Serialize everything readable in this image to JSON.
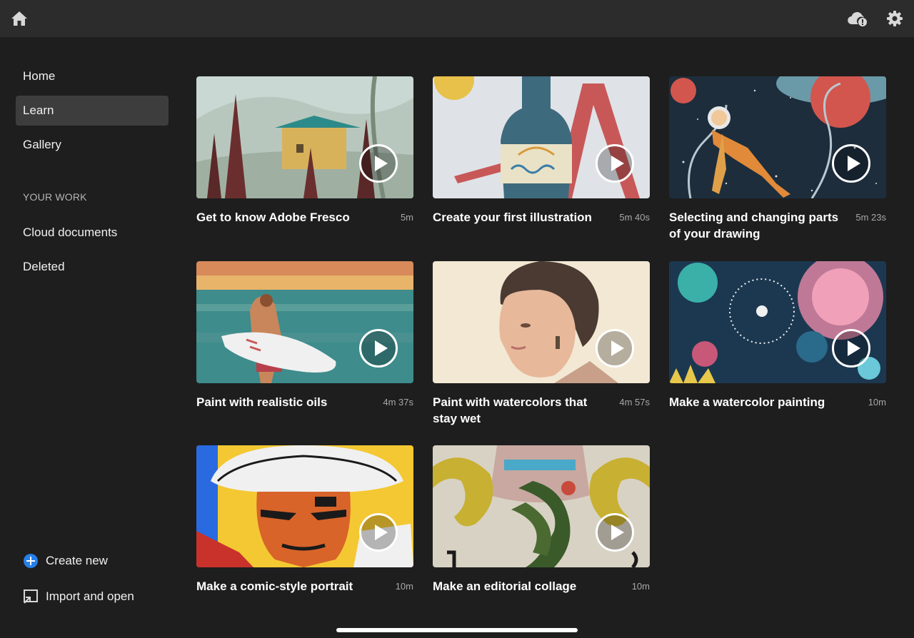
{
  "topbar": {
    "home_icon": "home-icon",
    "cloud_icon": "cloud-alert-icon",
    "settings_icon": "gear-icon"
  },
  "sidebar": {
    "items": [
      {
        "label": "Home"
      },
      {
        "label": "Learn",
        "active": true
      },
      {
        "label": "Gallery"
      }
    ],
    "section_header": "YOUR WORK",
    "work_items": [
      {
        "label": "Cloud documents"
      },
      {
        "label": "Deleted"
      }
    ],
    "create_new": "Create new",
    "import_open": "Import and open"
  },
  "tutorials": [
    {
      "title": "Get to know Adobe Fresco",
      "duration": "5m"
    },
    {
      "title": "Create your first illustration",
      "duration": "5m 40s"
    },
    {
      "title": "Selecting and changing parts of your drawing",
      "duration": "5m 23s"
    },
    {
      "title": "Paint with realistic oils",
      "duration": "4m 37s"
    },
    {
      "title": "Paint with watercolors that stay wet",
      "duration": "4m 57s"
    },
    {
      "title": "Make a watercolor painting",
      "duration": "10m"
    },
    {
      "title": "Make a comic-style portrait",
      "duration": "10m"
    },
    {
      "title": "Make an editorial collage",
      "duration": "10m"
    }
  ],
  "colors": {
    "accent": "#2680eb",
    "background": "#1e1e1e",
    "topbar": "#2c2c2c"
  }
}
